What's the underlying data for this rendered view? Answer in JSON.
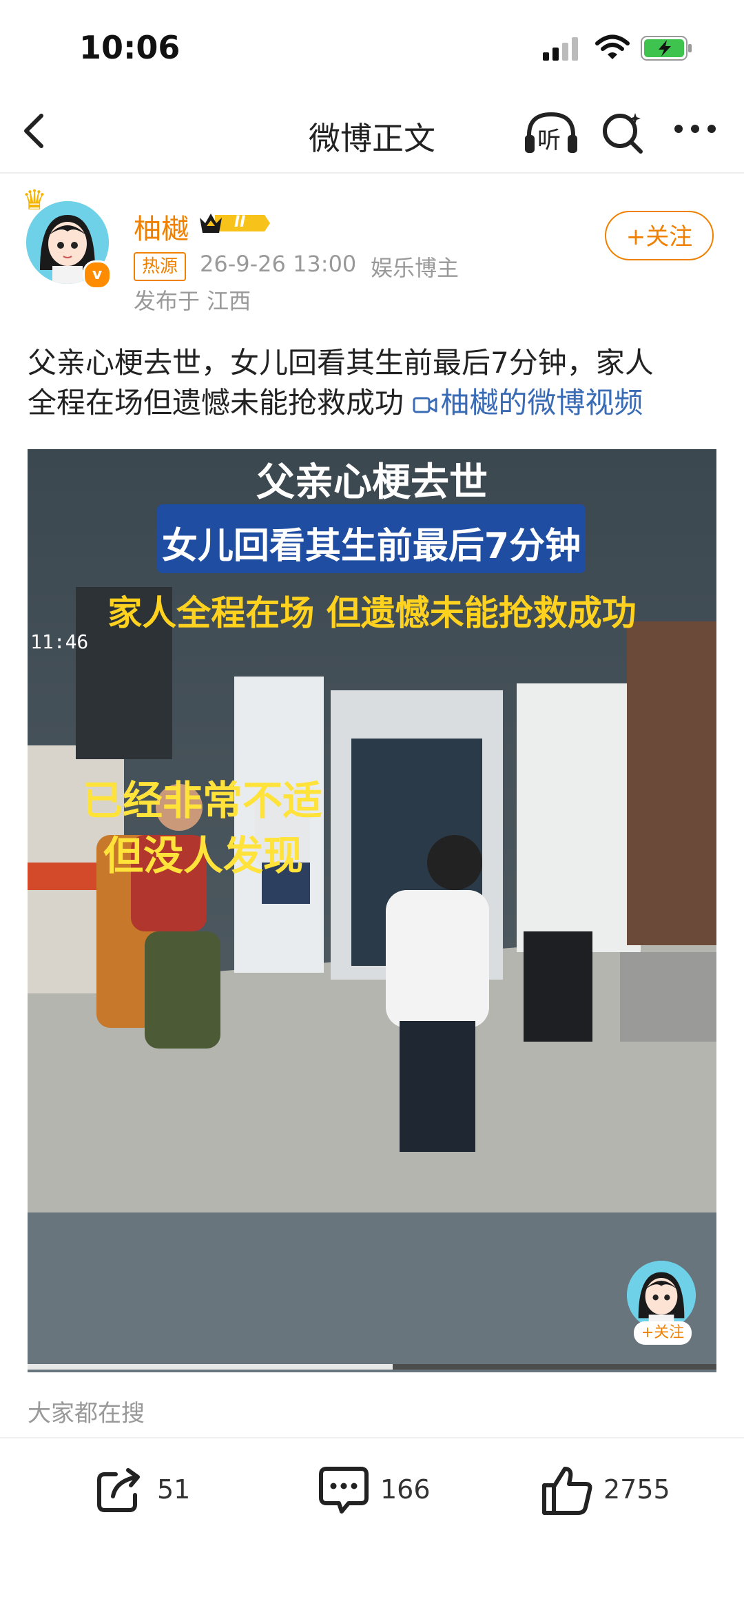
{
  "status_bar": {
    "time": "10:06"
  },
  "nav": {
    "title": "微博正文",
    "listen_label": "听"
  },
  "author": {
    "name": "柚樾",
    "verified_mark": "v",
    "badge_level": "II",
    "tag": "热源",
    "time": "26-9-26 13:00",
    "role": "娱乐博主",
    "location": "发布于 江西",
    "follow_label": "+关注"
  },
  "post": {
    "line1": "父亲心梗去世，女儿回看其生前最后7分钟，家人",
    "line2": "全程在场但遗憾未能抢救成功 ",
    "video_link": "柚樾的微博视频"
  },
  "video": {
    "caption_title": "父亲心梗去世",
    "caption_box": "女儿回看其生前最后7分钟",
    "caption_yellow": "家人全程在场  但遗憾未能抢救成功",
    "timestamp": "11:46",
    "caption_left_1": "已经非常不适",
    "caption_left_2": "但没人发现",
    "overlay_follow": "+关注",
    "progress": 0.53
  },
  "search_section": {
    "label": "大家都在搜"
  },
  "actions": {
    "repost_count": "51",
    "comment_count": "166",
    "like_count": "2755"
  },
  "colors": {
    "accent": "#f08000",
    "link": "#3a6bb5",
    "caption_box": "#1f4da1",
    "caption_yellow": "#ffd21f"
  }
}
